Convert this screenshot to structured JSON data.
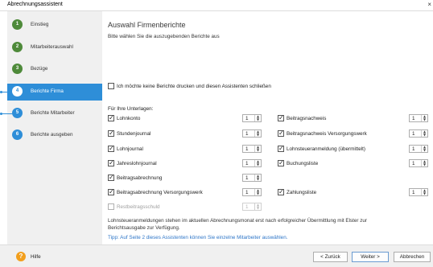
{
  "window": {
    "title": "Abrechnungsassistent",
    "close_glyph": "×"
  },
  "sidebar": {
    "accent": "#2e8ed8",
    "steps": [
      {
        "num": "1",
        "label": "Einstieg",
        "color": "#4e8a3a"
      },
      {
        "num": "2",
        "label": "Mitarbeiterauswahl",
        "color": "#4e8a3a"
      },
      {
        "num": "3",
        "label": "Bezüge",
        "color": "#4e8a3a"
      },
      {
        "num": "4",
        "label": "Berichte Firma",
        "color": "#2e8ed8"
      },
      {
        "num": "5",
        "label": "Berichte Mitarbeiter",
        "color": "#2e8ed8"
      },
      {
        "num": "6",
        "label": "Berichte ausgeben",
        "color": "#2e8ed8"
      }
    ]
  },
  "main": {
    "heading": "Auswahl Firmenberichte",
    "subheading": "Bitte wählen Sie die auszugebenden Berichte aus",
    "no_reports": {
      "label": "Ich möchte keine Berichte drucken und diesen Assistenten schließen",
      "checked": false
    },
    "group_label": "Für Ihre Unterlagen:",
    "left_reports": [
      {
        "label": "Lohnkonto",
        "checked": true,
        "count": "1",
        "enabled": true
      },
      {
        "label": "Stundenjournal",
        "checked": true,
        "count": "1",
        "enabled": true
      },
      {
        "label": "Lohnjournal",
        "checked": true,
        "count": "1",
        "enabled": true
      },
      {
        "label": "Jahreslohnjournal",
        "checked": true,
        "count": "1",
        "enabled": true
      },
      {
        "label": "Beitragsabrechnung",
        "checked": true,
        "count": "1",
        "enabled": true
      },
      {
        "label": "Beitragsabrechnung Versorgungswerk",
        "checked": true,
        "count": "1",
        "enabled": true
      },
      {
        "label": "Restbeitragsschuld",
        "checked": false,
        "count": "1",
        "enabled": false
      }
    ],
    "right_reports": [
      {
        "label": "Beitragsnachweis",
        "checked": true,
        "count": "1",
        "enabled": true
      },
      {
        "label": "Beitragsnachweis Versorgungswerk",
        "checked": true,
        "count": "1",
        "enabled": true
      },
      {
        "label": "Lohnsteueranmeldung (übermittelt)",
        "checked": true,
        "count": "1",
        "enabled": true
      },
      {
        "label": "Buchungsliste",
        "checked": true,
        "count": "1",
        "enabled": true
      },
      {
        "label": "Zahlungsliste",
        "checked": true,
        "count": "1",
        "enabled": true
      }
    ],
    "note_line1": "Lohnsteueranmeldungen stehen im aktuellen Abrechnungsmonat erst nach erfolgreicher Übermittlung mit Elster zur",
    "note_line2": "Berichtsausgabe zur Verfügung.",
    "tip": "Tipp: Auf Seite 2 dieses Assistenten können Sie einzelne Mitarbeiter auswählen."
  },
  "footer": {
    "help_glyph": "?",
    "help_label": "Hilfe",
    "back_label": "< Zurück",
    "next_label": "Weiter >",
    "cancel_label": "Abbrechen"
  }
}
